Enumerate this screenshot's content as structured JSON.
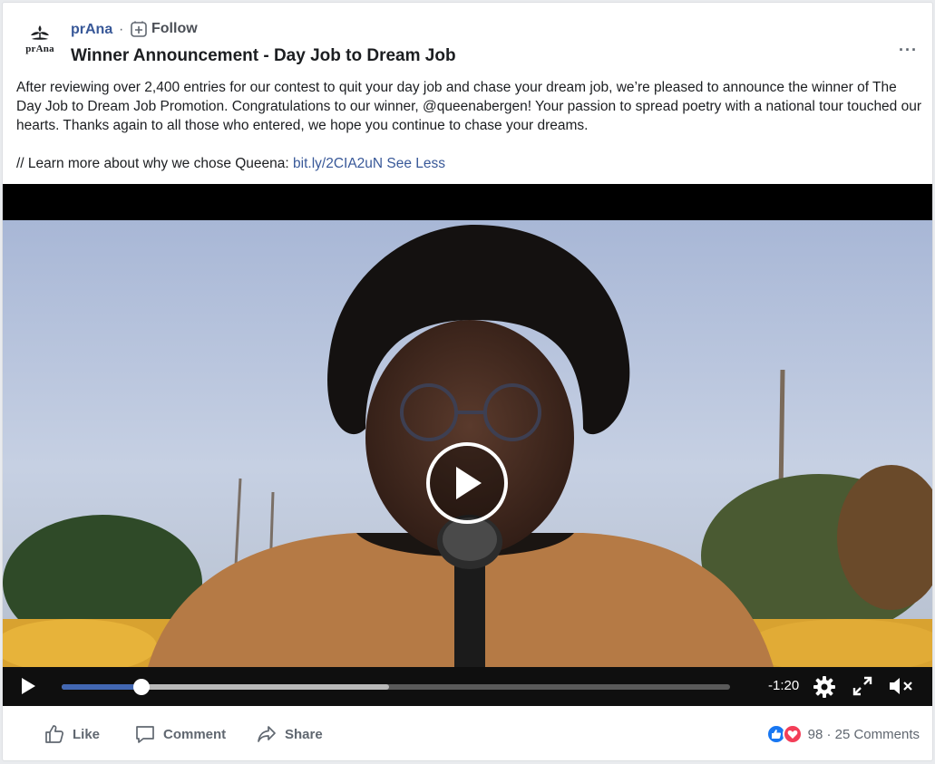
{
  "page": {
    "name": "prAna",
    "logo_text": "prAna",
    "separator": "·",
    "follow_label": "Follow"
  },
  "post": {
    "title": "Winner Announcement - Day Job to Dream Job",
    "paragraph1": "After reviewing over 2,400 entries for our contest to quit your day job and chase your dream job, we’re pleased to announce the winner of The Day Job to Dream Job Promotion. Congratulations to our winner, @queenabergen! Your passion to spread poetry with a national tour touched our hearts. Thanks again to all those who entered, we hope you continue to chase your dreams.",
    "paragraph2_prefix": "// Learn more about why we chose Queena: ",
    "link": "bit.ly/2CIA2uN",
    "see_less": "See Less",
    "more_options": "···"
  },
  "video": {
    "time_remaining": "-1:20",
    "progress_fraction": 0.12,
    "buffered_fraction": 0.49,
    "icons": [
      "play-icon",
      "settings-gear-icon",
      "fullscreen-icon",
      "muted-speaker-icon"
    ]
  },
  "actions": {
    "like": "Like",
    "comment": "Comment",
    "share": "Share"
  },
  "reactions": {
    "summary": "98 · 25 Comments",
    "like_color": "#1877f2",
    "love_color": "#f33e58"
  },
  "colors": {
    "link": "#385898",
    "progress": "#4267b2"
  }
}
